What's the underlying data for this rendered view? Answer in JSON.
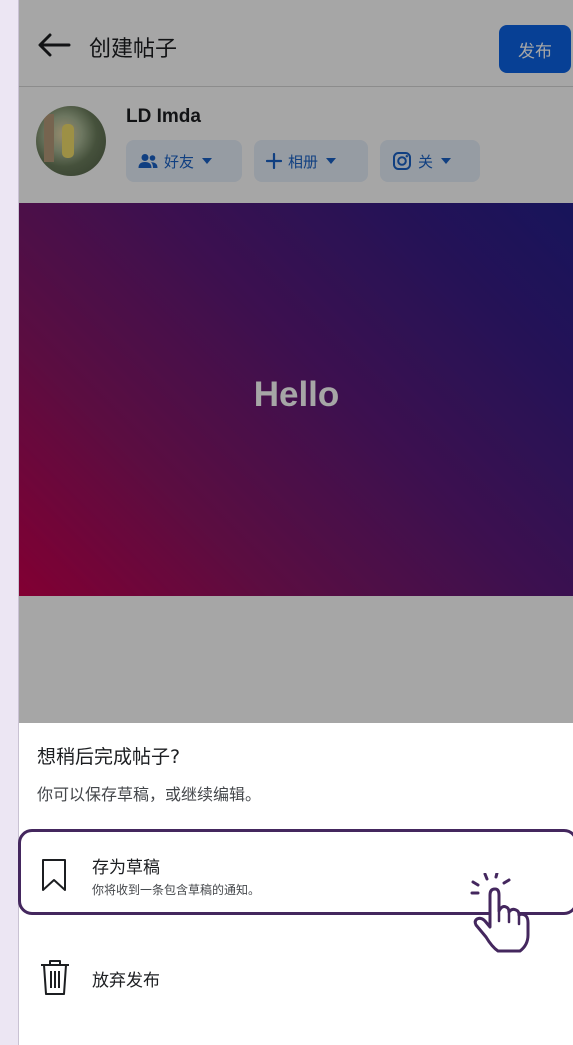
{
  "header": {
    "back_icon": "arrow-left-icon",
    "title": "创建帖子",
    "publish_label": "发布",
    "publish_color": "#0b63e5"
  },
  "profile": {
    "username": "LD Imda",
    "chips": [
      {
        "icon": "friends-icon",
        "label": "好友"
      },
      {
        "icon": "plus-icon",
        "label": "相册"
      },
      {
        "icon": "instagram-icon",
        "label": "关"
      }
    ]
  },
  "post": {
    "text": "Hello",
    "gradient_colors": [
      "#c8004e",
      "#241f8c"
    ]
  },
  "sheet": {
    "title": "想稍后完成帖子?",
    "subtitle": "你可以保存草稿，或继续编辑。",
    "save": {
      "icon": "bookmark-icon",
      "label": "存为草稿",
      "description": "你将收到一条包含草稿的通知。"
    },
    "discard": {
      "icon": "trash-icon",
      "label": "放弃发布"
    }
  },
  "overlay": {
    "highlight_color": "#44275e",
    "pointer_icon": "tap-hand-icon"
  }
}
